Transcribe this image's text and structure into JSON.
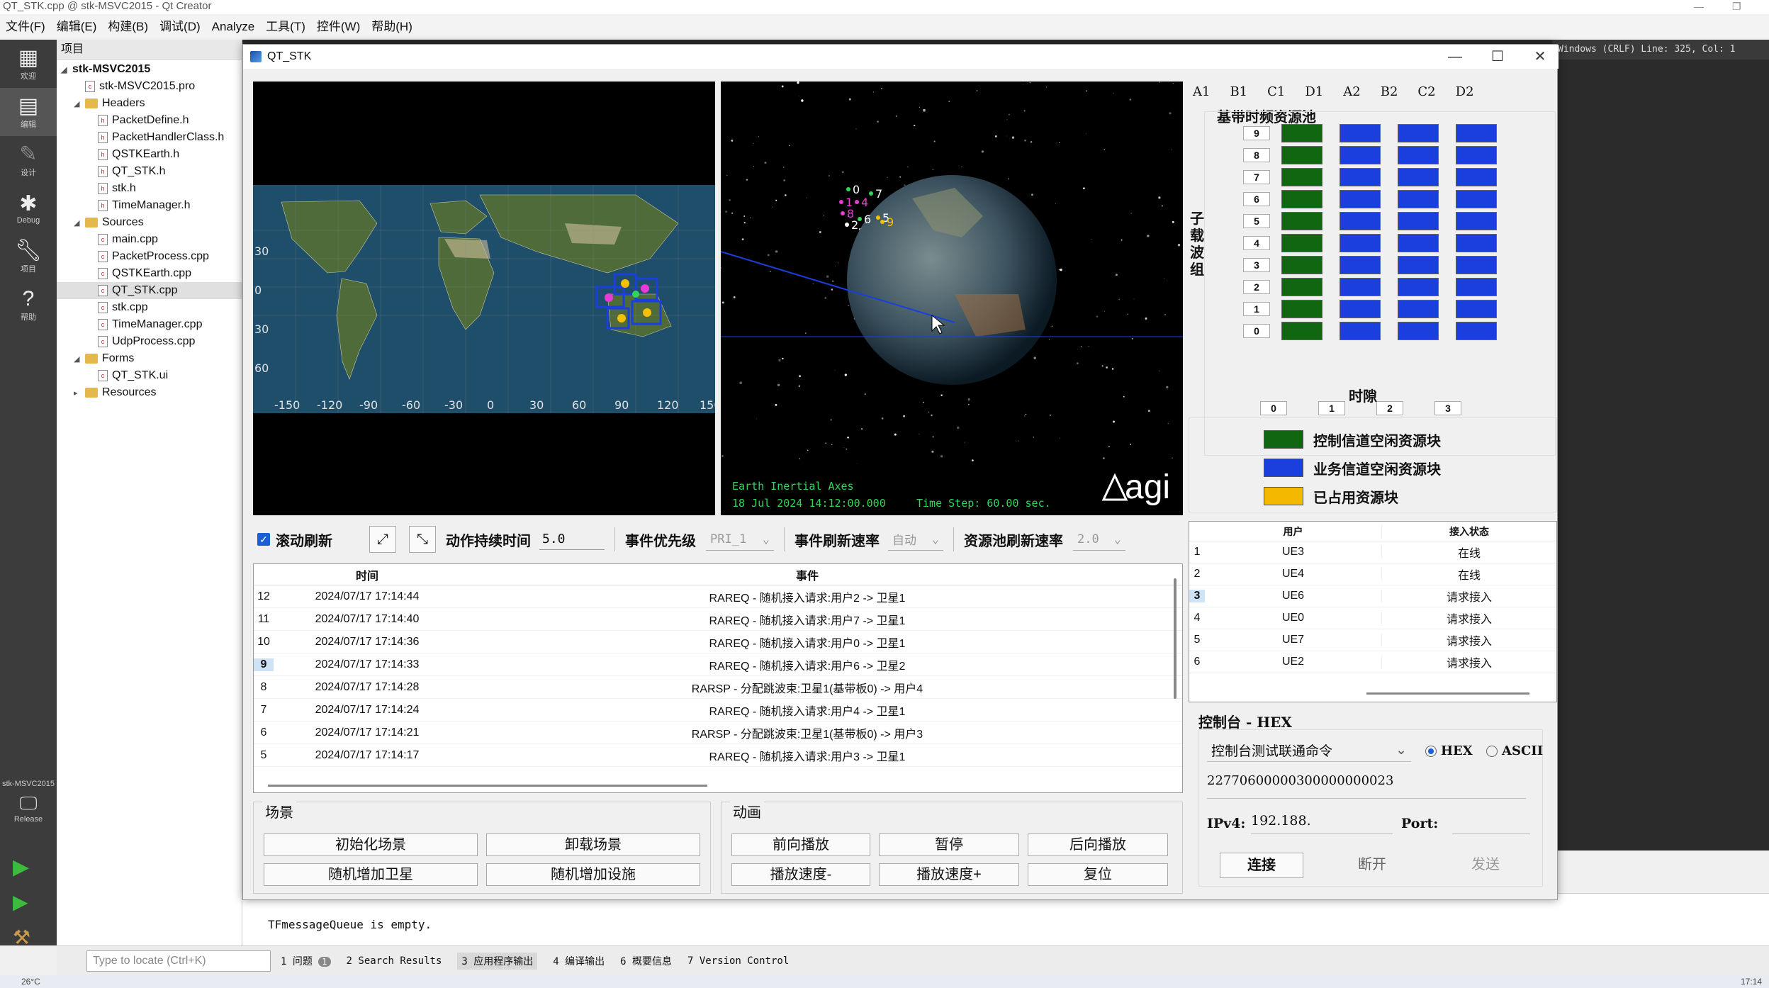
{
  "creator": {
    "window_title": "QT_STK.cpp @ stk-MSVC2015 - Qt Creator",
    "menus": [
      "文件(F)",
      "编辑(E)",
      "构建(B)",
      "调试(D)",
      "Analyze",
      "工具(T)",
      "控件(W)",
      "帮助(H)"
    ],
    "modes": [
      {
        "icon": "grid-icon",
        "label": "欢迎"
      },
      {
        "icon": "edit-icon",
        "label": "编辑"
      },
      {
        "icon": "design-icon",
        "label": "设计"
      },
      {
        "icon": "bug-icon",
        "label": "Debug"
      },
      {
        "icon": "wrench-icon",
        "label": "项目"
      },
      {
        "icon": "help-icon",
        "label": "帮助"
      }
    ],
    "kit_label": "stk-MSVC2015",
    "build_label": "Release",
    "project_header": "项目",
    "tree": [
      {
        "label": "stk-MSVC2015",
        "level": 0,
        "type": "project"
      },
      {
        "label": "stk-MSVC2015.pro",
        "level": 1,
        "type": "file"
      },
      {
        "label": "Headers",
        "level": 1,
        "type": "folder"
      },
      {
        "label": "PacketDefine.h",
        "level": 2,
        "type": "file"
      },
      {
        "label": "PacketHandlerClass.h",
        "level": 2,
        "type": "file"
      },
      {
        "label": "QSTKEarth.h",
        "level": 2,
        "type": "file"
      },
      {
        "label": "QT_STK.h",
        "level": 2,
        "type": "file"
      },
      {
        "label": "stk.h",
        "level": 2,
        "type": "file"
      },
      {
        "label": "TimeManager.h",
        "level": 2,
        "type": "file"
      },
      {
        "label": "Sources",
        "level": 1,
        "type": "folder"
      },
      {
        "label": "main.cpp",
        "level": 2,
        "type": "file"
      },
      {
        "label": "PacketProcess.cpp",
        "level": 2,
        "type": "file"
      },
      {
        "label": "QSTKEarth.cpp",
        "level": 2,
        "type": "file"
      },
      {
        "label": "QT_STK.cpp",
        "level": 2,
        "type": "file"
      },
      {
        "label": "stk.cpp",
        "level": 2,
        "type": "file"
      },
      {
        "label": "TimeManager.cpp",
        "level": 2,
        "type": "file"
      },
      {
        "label": "UdpProcess.cpp",
        "level": 2,
        "type": "file"
      },
      {
        "label": "Forms",
        "level": 1,
        "type": "folder"
      },
      {
        "label": "QT_STK.ui",
        "level": 2,
        "type": "file"
      },
      {
        "label": "Resources",
        "level": 1,
        "type": "folder"
      }
    ],
    "editor_status": "Windows (CRLF)   Line: 325, Col: 1",
    "output_text": "TFmessageQueue is empty.",
    "locator_placeholder": "Type to locate (Ctrl+K)",
    "bottom_tabs": [
      "1 问题",
      "2 Search Results",
      "3 应用程序输出",
      "4 编译输出",
      "6 概要信息",
      "7 Version Control"
    ],
    "problems_badge": "1",
    "taskbar_weather": "26°C",
    "taskbar_time": "17:14"
  },
  "qt": {
    "title": "QT_STK",
    "map_lat_labels": [
      "30",
      "0",
      "30",
      "60"
    ],
    "map_lon_labels": [
      "-150",
      "-120",
      "-90",
      "-60",
      "-30",
      "0",
      "30",
      "60",
      "90",
      "120",
      "150"
    ],
    "globe_text_axes": "Earth Inertial Axes",
    "globe_text_time": "18 Jul 2024 14:12:00.000",
    "globe_text_step": "Time Step: 60.00 sec.",
    "agi_logo": "agi",
    "sat_labels": [
      "0",
      "7",
      "1",
      "4",
      "8",
      "6",
      "5",
      "9",
      "2"
    ],
    "toolbar": {
      "scroll_checkbox": "滚动刷新",
      "duration_label": "动作持续时间",
      "duration_value": "5.0",
      "priority_label": "事件优先级",
      "priority_value": "PRI_1",
      "event_rate_label": "事件刷新速率",
      "event_rate_value": "自动",
      "pool_rate_label": "资源池刷新速率",
      "pool_rate_value": "2.0"
    },
    "event_table": {
      "headers": [
        "时间",
        "事件"
      ],
      "rows": [
        {
          "num": "12",
          "time": "2024/07/17 17:14:44",
          "event": "RAREQ - 随机接入请求:用户2 -> 卫星1"
        },
        {
          "num": "11",
          "time": "2024/07/17 17:14:40",
          "event": "RAREQ - 随机接入请求:用户7 -> 卫星1"
        },
        {
          "num": "10",
          "time": "2024/07/17 17:14:36",
          "event": "RAREQ - 随机接入请求:用户0 -> 卫星1"
        },
        {
          "num": "9",
          "time": "2024/07/17 17:14:33",
          "event": "RAREQ - 随机接入请求:用户6 -> 卫星2"
        },
        {
          "num": "8",
          "time": "2024/07/17 17:14:28",
          "event": "RARSP - 分配跳波束:卫星1(基带板0) -> 用户4"
        },
        {
          "num": "7",
          "time": "2024/07/17 17:14:24",
          "event": "RAREQ - 随机接入请求:用户4 -> 卫星1"
        },
        {
          "num": "6",
          "time": "2024/07/17 17:14:21",
          "event": "RARSP - 分配跳波束:卫星1(基带板0) -> 用户3"
        },
        {
          "num": "5",
          "time": "2024/07/17 17:14:17",
          "event": "RAREQ - 随机接入请求:用户3 -> 卫星1"
        }
      ]
    },
    "scene": {
      "title": "场景",
      "init": "初始化场景",
      "unload": "卸载场景",
      "add_sat": "随机增加卫星",
      "add_facility": "随机增加设施"
    },
    "anim": {
      "title": "动画",
      "forward": "前向播放",
      "pause": "暂停",
      "backward": "后向播放",
      "slower": "播放速度-",
      "faster": "播放速度+",
      "reset": "复位"
    },
    "freq_tabs": [
      "A1",
      "B1",
      "C1",
      "D1",
      "A2",
      "B2",
      "C2",
      "D2"
    ],
    "pool": {
      "title": "基带时频资源池",
      "y_axis": "子载波组",
      "x_axis": "时隙",
      "row_labels": [
        "9",
        "8",
        "7",
        "6",
        "5",
        "4",
        "3",
        "2",
        "1",
        "0"
      ],
      "col_labels": [
        "0",
        "1",
        "2",
        "3"
      ],
      "grid": [
        [
          "g",
          "b",
          "b",
          "b"
        ],
        [
          "g",
          "b",
          "b",
          "b"
        ],
        [
          "g",
          "b",
          "b",
          "b"
        ],
        [
          "g",
          "b",
          "b",
          "b"
        ],
        [
          "g",
          "b",
          "b",
          "b"
        ],
        [
          "g",
          "b",
          "b",
          "b"
        ],
        [
          "g",
          "b",
          "b",
          "b"
        ],
        [
          "g",
          "b",
          "b",
          "b"
        ],
        [
          "g",
          "b",
          "b",
          "b"
        ],
        [
          "g",
          "b",
          "b",
          "b"
        ]
      ],
      "colors": {
        "g": "#116611",
        "b": "#1a3fdd",
        "y": "#f5b800"
      }
    },
    "legend": [
      {
        "color": "#116611",
        "label": "控制信道空闲资源块"
      },
      {
        "color": "#1a3fdd",
        "label": "业务信道空闲资源块"
      },
      {
        "color": "#f5b800",
        "label": "已占用资源块"
      }
    ],
    "user_table": {
      "headers": [
        "用户",
        "接入状态"
      ],
      "rows": [
        {
          "n": "1",
          "user": "UE3",
          "status": "在线"
        },
        {
          "n": "2",
          "user": "UE4",
          "status": "在线"
        },
        {
          "n": "3",
          "user": "UE6",
          "status": "请求接入"
        },
        {
          "n": "4",
          "user": "UE0",
          "status": "请求接入"
        },
        {
          "n": "5",
          "user": "UE7",
          "status": "请求接入"
        },
        {
          "n": "6",
          "user": "UE2",
          "status": "请求接入"
        }
      ]
    },
    "console": {
      "title": "控制台 - HEX",
      "command": "控制台测试联通命令",
      "hex_label": "HEX",
      "ascii_label": "ASCII",
      "hex_value": "22770600000300000000023",
      "ip_label": "IPv4:",
      "ip_value": "192.188.",
      "port_label": "Port:",
      "port_value": "",
      "connect": "连接",
      "disconnect": "断开",
      "send": "发送"
    }
  }
}
